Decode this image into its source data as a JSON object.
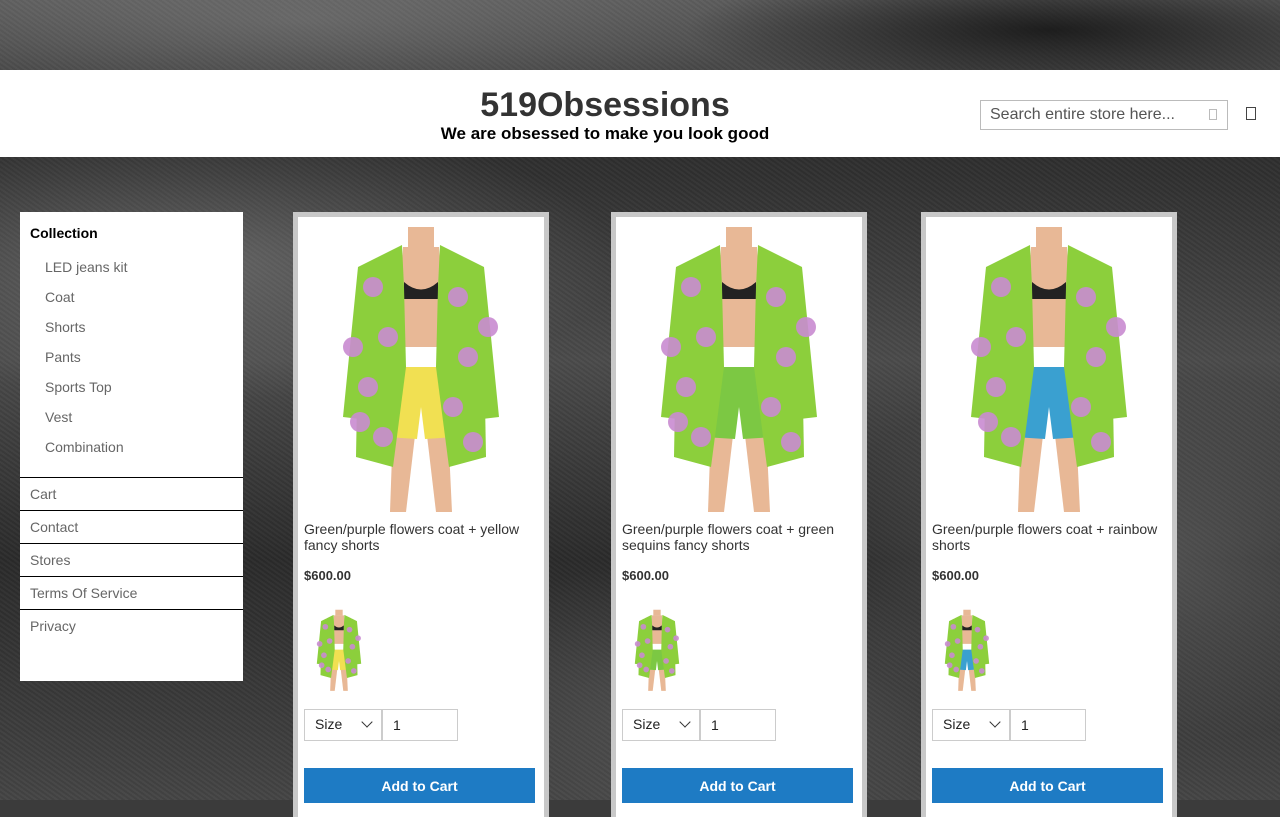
{
  "header": {
    "brand": "519Obsessions",
    "tagline": "We are obsessed to make you look good",
    "search_placeholder": "Search entire store here...",
    "search_icon": "search-icon",
    "cart_icon": "cart-icon"
  },
  "sidebar": {
    "heading": "Collection",
    "collections": [
      "LED jeans kit",
      "Coat",
      "Shorts",
      "Pants",
      "Sports Top",
      "Vest",
      "Combination"
    ],
    "pages": [
      "Cart",
      "Contact",
      "Stores",
      "Terms Of Service",
      "Privacy"
    ]
  },
  "products": [
    {
      "title": "Green/purple flowers coat + yellow fancy shorts",
      "price": "$600.00",
      "size_label": "Size",
      "quantity": "1",
      "button": "Add to Cart",
      "shorts_color": "#f1e052"
    },
    {
      "title": "Green/purple flowers coat + green sequins fancy shorts",
      "price": "$600.00",
      "size_label": "Size",
      "quantity": "1",
      "button": "Add to Cart",
      "shorts_color": "#7cc843"
    },
    {
      "title": "Green/purple flowers coat + rainbow shorts",
      "price": "$600.00",
      "size_label": "Size",
      "quantity": "1",
      "button": "Add to Cart",
      "shorts_color": "#3aa0d0"
    }
  ],
  "colors": {
    "button": "#1e7bc4",
    "coat_green": "#8ccf3c",
    "flower_purple": "#c98bd0"
  }
}
